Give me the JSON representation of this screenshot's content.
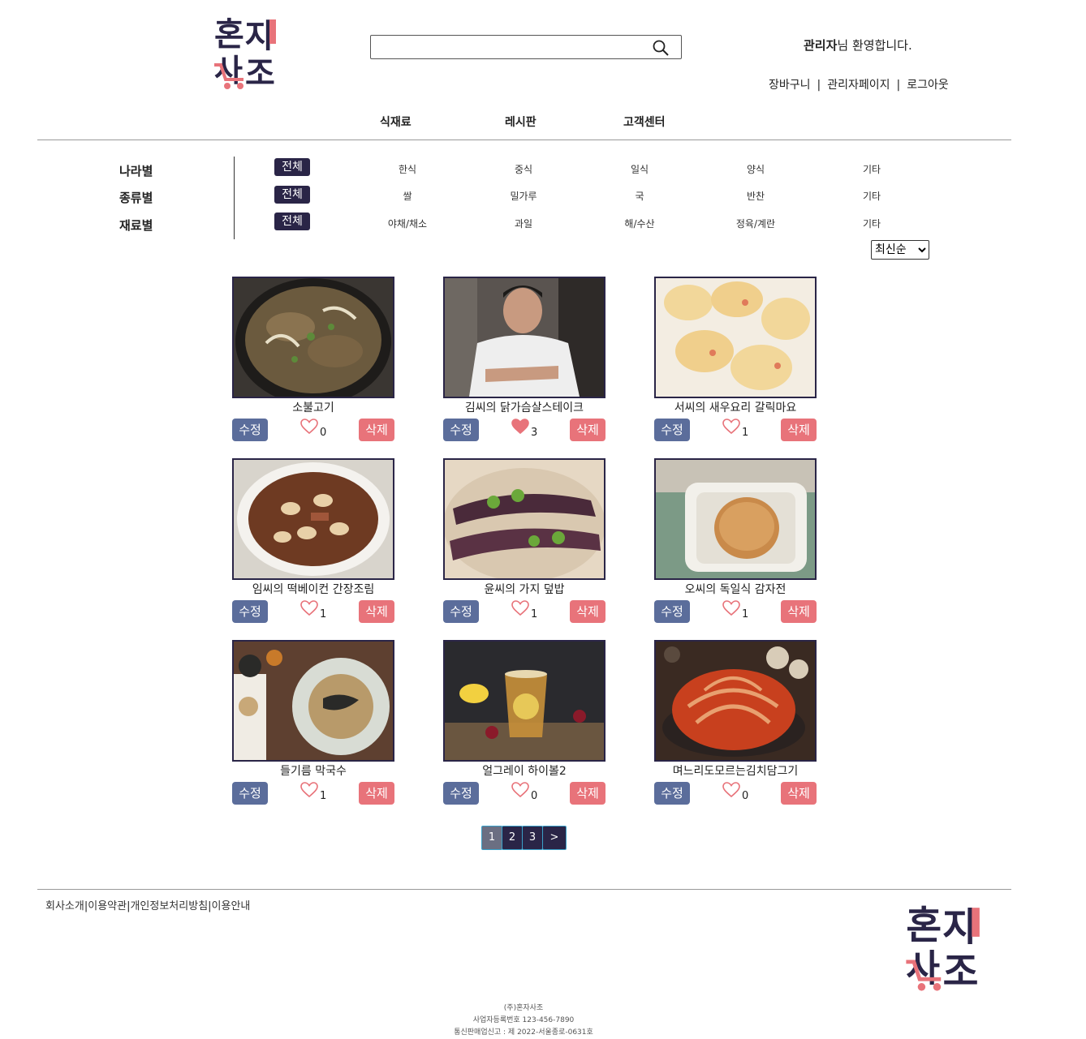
{
  "brand": {
    "logo_text_top": "혼자",
    "logo_text_bottom": "사조",
    "colors": {
      "navy": "#2a2547",
      "pink": "#e8737a",
      "blue_btn": "#5b6d9b"
    }
  },
  "header": {
    "search": {
      "value": "",
      "placeholder": "",
      "icon": "search-icon"
    },
    "welcome_user": "관리자",
    "welcome_suffix": "님 환영합니다.",
    "links": [
      "장바구니",
      "관리자페이지",
      "로그아웃"
    ],
    "separator": "|"
  },
  "nav": {
    "items": [
      "식재료",
      "레시판",
      "고객센터"
    ]
  },
  "filters": {
    "all_label": "전체",
    "rows": [
      {
        "label": "나라별",
        "options": [
          "한식",
          "중식",
          "일식",
          "양식",
          "기타"
        ]
      },
      {
        "label": "종류별",
        "options": [
          "쌀",
          "밀가루",
          "국",
          "반찬",
          "기타"
        ]
      },
      {
        "label": "재료별",
        "options": [
          "야채/채소",
          "과일",
          "해/수산",
          "정육/계란",
          "기타"
        ]
      }
    ]
  },
  "sort": {
    "selected": "최신순"
  },
  "card_labels": {
    "edit": "수정",
    "delete": "삭제"
  },
  "recipes": [
    {
      "title": "소불고기",
      "likes": "0",
      "liked": false,
      "image": "bulgogi-photo"
    },
    {
      "title": "김씨의 닭가슴살스테이크",
      "likes": "3",
      "liked": true,
      "image": "chef-portrait-photo"
    },
    {
      "title": "서씨의 새우요리 갈릭마요",
      "likes": "1",
      "liked": false,
      "image": "garlic-mayo-shrimp-photo"
    },
    {
      "title": "임씨의 떡베이컨 간장조림",
      "likes": "1",
      "liked": false,
      "image": "rice-cake-bacon-photo"
    },
    {
      "title": "윤씨의 가지 덮밥",
      "likes": "1",
      "liked": false,
      "image": "eggplant-rice-bowl-photo"
    },
    {
      "title": "오씨의 독일식 감자전",
      "likes": "1",
      "liked": false,
      "image": "potato-pancake-photo"
    },
    {
      "title": "들기름 막국수",
      "likes": "1",
      "liked": false,
      "image": "perilla-oil-noodles-photo"
    },
    {
      "title": "얼그레이 하이볼2",
      "likes": "0",
      "liked": false,
      "image": "earl-grey-highball-photo"
    },
    {
      "title": "며느리도모르는김치담그기",
      "likes": "0",
      "liked": false,
      "image": "kimchi-photo"
    }
  ],
  "pagination": {
    "pages": [
      "1",
      "2",
      "3"
    ],
    "next": ">",
    "current": "1"
  },
  "footer": {
    "links": [
      "회사소개",
      "이용약관",
      "개인정보처리방침",
      "이용안내"
    ],
    "company": "(주)혼자사조",
    "business_no": "사업자등록번호 123-456-7890",
    "mail_order": "통신판매업신고 : 제 2022-서울종로-0631호"
  }
}
